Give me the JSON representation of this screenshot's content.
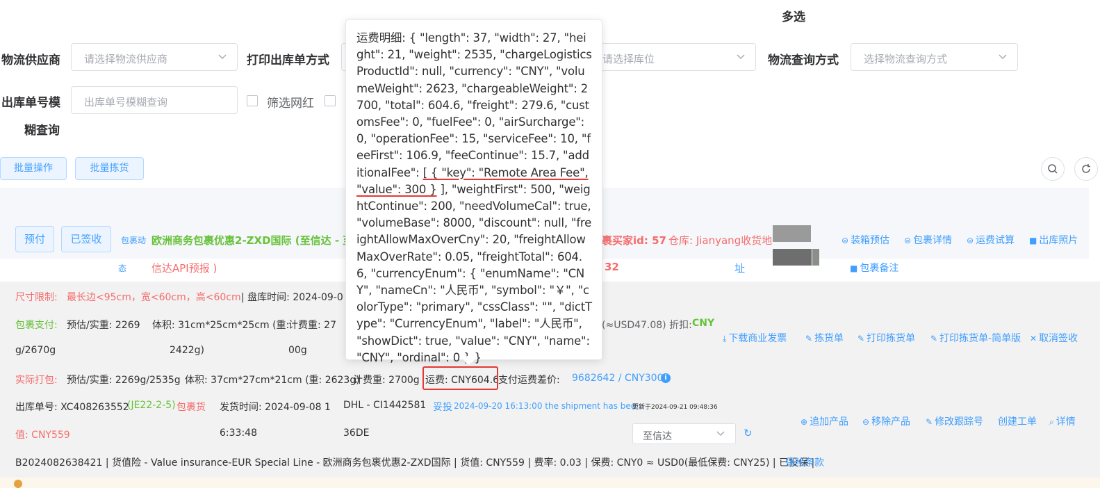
{
  "filters": {
    "multi_select_label": "多选",
    "logistics_supplier_label": "物流供应商",
    "logistics_supplier_placeholder": "请选择物流供应商",
    "print_method_label": "打印出库单方式",
    "location_placeholder": "请选择库位",
    "logistics_query_label": "物流查询方式",
    "logistics_query_placeholder": "选择物流查询方式",
    "outbound_no_label_1": "出库单号模",
    "outbound_no_label_2": "糊查询",
    "outbound_no_placeholder": "出库单号模糊查询",
    "influencer_filter_label": "筛选网红"
  },
  "toolbar": {
    "batch_ops": "批量操作",
    "batch_pick": "批量拣货"
  },
  "order": {
    "tag_prepaid": "预付",
    "tag_signed": "已签收",
    "status_label_1": "包裹动",
    "status_label_2": "态",
    "product_line_1": "欧洲商务包裹优惠2-ZXD国际 (至信达 - 至",
    "product_line_2": "信达API预报 )",
    "buyer_id_1": "裹买家id: 57",
    "buyer_id_2": "32",
    "warehouse": "仓库: Jianyang收货地",
    "warehouse_2": "址",
    "actions_row1": [
      "装箱预估",
      "包裹详情",
      "运费试算",
      "出库照片"
    ],
    "action_note": "包裹备注",
    "size_limit_label": "尺寸限制:",
    "size_limit_value": "最长边<95cm，宽<60cm，高<60cm",
    "stocktake_time": "| 盘库时间: 2024-09-0",
    "pkg_pay_label": "包裹支付:",
    "pkg_pay_est": "预估/实重: 2269",
    "pkg_pay_est_2": "g/2670g",
    "pkg_pay_vol": "体积: 31cm*25cm*25cm (重:",
    "pkg_pay_vol_2": "2422g)",
    "pkg_pay_charge": "计费重: 27",
    "pkg_pay_charge_2": "00g",
    "pkg_pay_usd": "(≈USD47.08) 折扣:",
    "pkg_pay_cny": "CNY",
    "actions_row2": [
      "下载商业发票",
      "拣货单",
      "打印拣货单",
      "打印拣货单-简单版",
      "取消签收"
    ],
    "actual_pack_label": "实际打包:",
    "actual_pack_est": "预估/实重: 2269g/2535g",
    "actual_pack_vol": "体积: 37cm*27cm*21cm (重: 2623g)",
    "actual_pack_charge": "计费重: 2700g",
    "freight": "运费: CNY604.6",
    "freight_diff_label": "支付运费差价:",
    "freight_diff_value": "9682642 / CNY300",
    "outbound_no": "出库单号: XC408263552",
    "outbound_loc": "(JE22-2-5)",
    "outbound_tag": "包裹货",
    "ship_time_1": "发货时间: 2024-09-08 1",
    "ship_time_2": "6:33:48",
    "carrier_1": "DHL - CI1442581",
    "carrier_2": "36DE",
    "tracking_status": "妥投",
    "tracking_detail": "2024-09-20 16:13:00 the shipment has bee...",
    "updated_at": "更新于2024-09-21 09:48:36",
    "value_label": "值: CNY559",
    "channel_select": "至信达",
    "actions_row3": [
      "追加产品",
      "移除产品",
      "修改跟踪号",
      "创建工单",
      "详情"
    ],
    "insurance_line": "B2024082638421 | 货值险 - Value insurance-EUR Special Line - 欧洲商务包裹优惠2-ZXD国际 | 货值: CNY559 | 费率: 0.03 | 保费: CNY0 ≈ USD0(最低保费: CNY25) | 已投保 |",
    "insurance_terms": "保险条款"
  },
  "popover": {
    "before_underline": "运费明细: { \"length\": 37, \"width\": 27, \"height\": 21, \"weight\": 2535, \"chargeLogisticsProductId\": null, \"currency\": \"CNY\", \"volumeWeight\": 2623, \"chargeableWeight\": 2700, \"total\": 604.6, \"freight\": 279.6, \"customsFee\": 0, \"fuelFee\": 0, \"airSurcharge\": 0, \"operationFee\": 15, \"serviceFee\": 10, \"feeFirst\": 106.9, \"feeContinue\": 15.7, \"additionalFee\": ",
    "underlined": "[ { \"key\": \"Remote Area Fee\", \"value\": 300 }",
    "after_underline": " ], \"weightFirst\": 500, \"weightContinue\": 200, \"needVolumeCal\": true, \"volumeBase\": 8000, \"discount\": null, \"freightAllowMaxOverCny\": 20, \"freightAllowMaxOverRate\": 0.05, \"freightTotal\": 604.6, \"currencyEnum\": { \"enumName\": \"CNY\", \"nameCn\": \"人民币\", \"symbol\": \"￥\", \"colorType\": \"primary\", \"cssClass\": \"\", \"dictType\": \"CurrencyEnum\", \"label\": \"人民币\", \"showDict\": true, \"value\": \"CNY\", \"name\": \"CNY\", \"ordinal\": 0 } }"
  },
  "colors": {
    "primary": "#409eff",
    "danger": "#f56c6c",
    "success": "#67c23a",
    "highlight_box": "#e53935"
  }
}
